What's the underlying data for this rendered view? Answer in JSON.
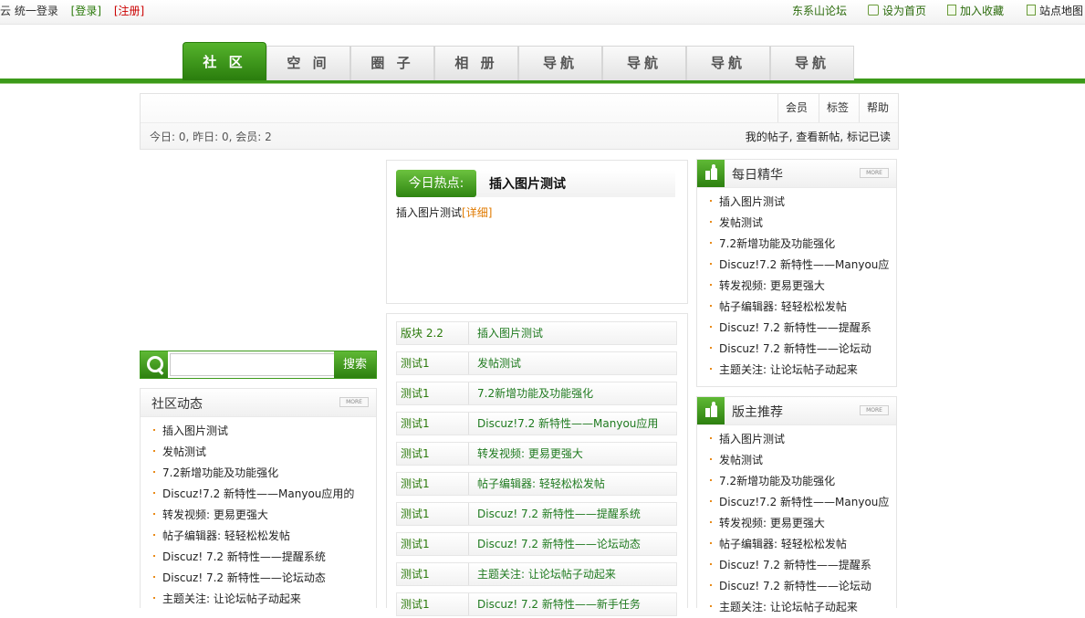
{
  "topbar": {
    "unified_login": "云 统一登录",
    "login": "[登录]",
    "register": "[注册]",
    "site_name": "东系山论坛",
    "set_home": "设为首页",
    "add_fav": "加入收藏",
    "sitemap": "站点地图"
  },
  "nav": {
    "tabs": [
      "社 区",
      "空 间",
      "圈 子",
      "相 册",
      "导航",
      "导航",
      "导航",
      "导航"
    ],
    "active_index": 0
  },
  "infobar": {
    "links": [
      "会员",
      "标签",
      "帮助"
    ],
    "stats": "今日: 0, 昨日: 0, 会员: 2",
    "my_links": "我的帖子, 查看新帖, 标记已读"
  },
  "search": {
    "placeholder": "",
    "button": "搜索"
  },
  "community": {
    "title": "社区动态",
    "more": "MORE",
    "items": [
      "插入图片测试",
      "发帖测试",
      "7.2新增功能及功能强化",
      "Discuz!7.2 新特性——Manyou应用的",
      "转发视频: 更易更强大",
      "帖子编辑器: 轻轻松松发帖",
      "Discuz! 7.2 新特性——提醒系统",
      "Discuz! 7.2 新特性——论坛动态",
      "主题关注: 让论坛帖子动起来"
    ]
  },
  "hot": {
    "label": "今日热点:",
    "title": "插入图片测试",
    "desc": "插入图片测试",
    "detail": "[详细]"
  },
  "threads": [
    {
      "cat": "版块 2.2",
      "title": "插入图片测试"
    },
    {
      "cat": "测试1",
      "title": "发帖测试"
    },
    {
      "cat": "测试1",
      "title": "7.2新增功能及功能强化"
    },
    {
      "cat": "测试1",
      "title": "Discuz!7.2 新特性——Manyou应用"
    },
    {
      "cat": "测试1",
      "title": "转发视频: 更易更强大"
    },
    {
      "cat": "测试1",
      "title": "帖子编辑器: 轻轻松松发帖"
    },
    {
      "cat": "测试1",
      "title": "Discuz! 7.2 新特性——提醒系统"
    },
    {
      "cat": "测试1",
      "title": "Discuz! 7.2 新特性——论坛动态"
    },
    {
      "cat": "测试1",
      "title": "主题关注: 让论坛帖子动起来"
    },
    {
      "cat": "测试1",
      "title": "Discuz! 7.2 新特性——新手任务"
    }
  ],
  "daily": {
    "title": "每日精华",
    "more": "MORE",
    "items": [
      "插入图片测试",
      "发帖测试",
      "7.2新增功能及功能强化",
      "Discuz!7.2 新特性——Manyou应",
      "转发视频: 更易更强大",
      "帖子编辑器: 轻轻松松发帖",
      "Discuz! 7.2 新特性——提醒系",
      "Discuz! 7.2 新特性——论坛动",
      "主题关注: 让论坛帖子动起来"
    ]
  },
  "mod": {
    "title": "版主推荐",
    "more": "MORE",
    "items": [
      "插入图片测试",
      "发帖测试",
      "7.2新增功能及功能强化",
      "Discuz!7.2 新特性——Manyou应",
      "转发视频: 更易更强大",
      "帖子编辑器: 轻轻松松发帖",
      "Discuz! 7.2 新特性——提醒系",
      "Discuz! 7.2 新特性——论坛动",
      "主题关注: 让论坛帖子动起来"
    ]
  },
  "colors": {
    "brand_green": "#3c9a1a",
    "link_green": "#2b7a0b",
    "register_red": "#cc0000",
    "bullet_orange": "#e98b1a"
  }
}
